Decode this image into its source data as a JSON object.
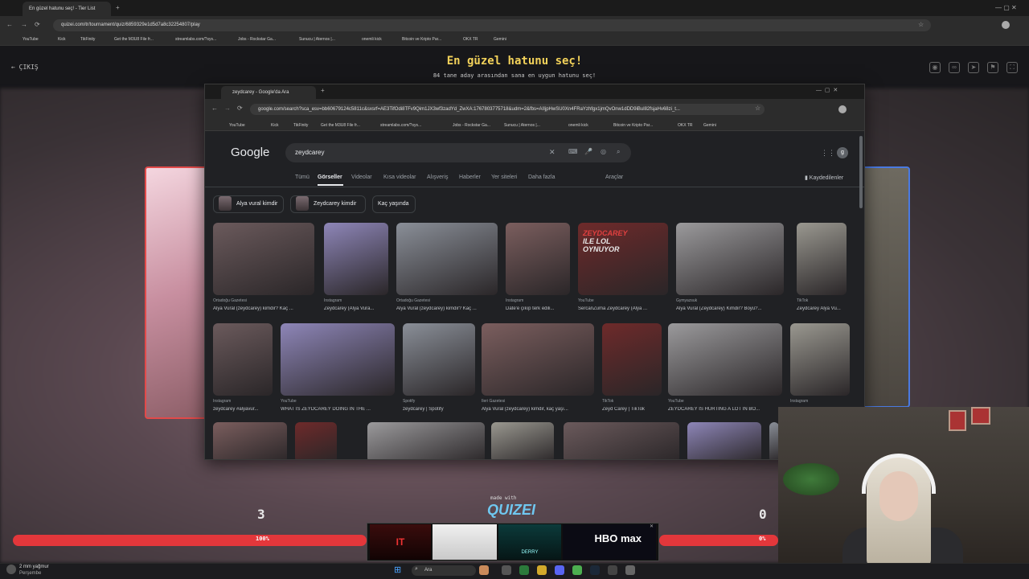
{
  "browser": {
    "tab_title": "En güzel hatunu seç! - Tier List",
    "url": "quizei.com/tr/tournament/quiz/6859329e1d5d7a8c32254807/play",
    "bookmarks": [
      "YouTube",
      "Kick",
      "TikFinity",
      "Get the M3U8 File fr...",
      "streamlabs.com/?sys...",
      "Jobs - Rockstar Ga...",
      "Sunucu | Aternos |...",
      "onemli kick",
      "Bitcoin ve Kripto Par...",
      "OKX TR",
      "Gemini"
    ]
  },
  "quiz": {
    "exit_label": "ÇIKIŞ",
    "title": "En güzel hatunu seç!",
    "subtitle": "84 tane aday arasından sana en uygun hatunu seç!",
    "score_left": "3",
    "score_right": "0",
    "made_with": "made with",
    "brand": "QUIZEI",
    "left_percent": "100%",
    "right_percent": "0%",
    "accent": "#f3d25a",
    "bar_color": "#e3373b"
  },
  "google": {
    "tab_title": "zeydcarey - Google'da Ara",
    "url": "google.com/search?sca_esv=bb60679124c5811c&sxsrf=AE3TifOdi8TFv9Qim1JX3wf3zadYd_ZwXA:1767803775718&udm=2&fbs=AIIjpHwSU0Xn4FRaYzhfgx1jmQvOnw1dDD9iBul82fsjaHv68zi_t...",
    "logo": "Google",
    "query": "zeydcarey",
    "tabs": [
      "Tümü",
      "Görseller",
      "Videolar",
      "Kısa videolar",
      "Alışveriş",
      "Haberler",
      "Yer siteleri",
      "Daha fazla"
    ],
    "active_tab": "Görseller",
    "tools": "Araçlar",
    "saved": "Kaydedilenler",
    "avatar_letter": "g",
    "chips": [
      "Alya vural kimdir",
      "Zeydcarey kimdir",
      "Kaç yaşında"
    ],
    "row1": [
      {
        "source": "Ortadoğu Gazetesi",
        "caption": "Alya Vural (zeydcarey) kimdir? Kaç ..."
      },
      {
        "source": "Instagram",
        "caption": "Zeydcarey (Alya Vura..."
      },
      {
        "source": "Ortadoğu Gazetesi",
        "caption": "Alya Vural (zeydcarey) kimdir? Kaç ..."
      },
      {
        "source": "Instagram",
        "caption": "Date'e çıkıp terk edili..."
      },
      {
        "source": "YouTube",
        "caption": "SercanZuma Zeydcarey (Alya ..."
      },
      {
        "source": "Gymyazsuk",
        "caption": "Alya Vural (Zeydcarey) Kimdir? Boyu?..."
      },
      {
        "source": "TikTok",
        "caption": "Zeydcarey Alya Vu..."
      }
    ],
    "row2": [
      {
        "source": "Instagram",
        "caption": "zeydcarey #alyavur..."
      },
      {
        "source": "YouTube",
        "caption": "WHAT IS ZEYDCAREY DOING IN THE ..."
      },
      {
        "source": "Spotify",
        "caption": "zeydcarey | Spotify"
      },
      {
        "source": "İleri Gazetesi",
        "caption": "Alya Vural (zeydcarey) kimdir, kaç yaşı..."
      },
      {
        "source": "TikTok",
        "caption": "Zeyd Carey | TikTok"
      },
      {
        "source": "YouTube",
        "caption": "ZEYDCAREY IS HURTING A LOT IN BO..."
      },
      {
        "source": "Instagram",
        "caption": ""
      }
    ],
    "overlay_texts": [
      "ZEYDCAREY",
      "ILE LOL",
      "OYNUYOR",
      "ZEYDCAREY",
      "ZEYDCAREY",
      "ZEYDCAREY"
    ]
  },
  "ad": {
    "logo": "HBO max",
    "tile1": "IT",
    "tile3": "DERRY"
  },
  "taskbar": {
    "weather_line1": "2 mm yağmur",
    "weather_line2": "Perşembe",
    "search_placeholder": "Ara"
  }
}
